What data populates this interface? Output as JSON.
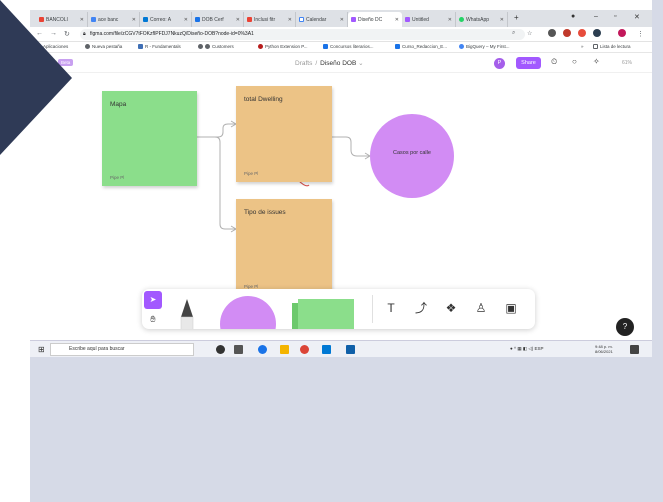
{
  "colors": {
    "slide_accent": "#2f3a56",
    "figma_purple": "#a259ff",
    "sticky_green": "#8bde8b",
    "sticky_orange": "#ecc386",
    "circle_purple": "#d28cf4"
  },
  "browser": {
    "tabs": [
      {
        "label": "BANCOLI",
        "favicon": "gmail-icon"
      },
      {
        "label": "ace banc",
        "favicon": "google-icon"
      },
      {
        "label": "Correo: A",
        "favicon": "outlook-icon"
      },
      {
        "label": "DOB Cerf",
        "favicon": "docs-icon"
      },
      {
        "label": "Inclusi fitr",
        "favicon": "gmail-icon"
      },
      {
        "label": "Calendar",
        "favicon": "calendar-icon"
      },
      {
        "label": "Diseño DC",
        "favicon": "figma-icon"
      },
      {
        "label": "Untitled",
        "favicon": "figma-icon"
      },
      {
        "label": "WhatsApp",
        "favicon": "whatsapp-icon"
      }
    ],
    "new_tab": "+",
    "url": "figma.com/file/zCGV7tFOKzfIPFDJ7NkuzQ/Diseño-DOB?node-id=0%3A1",
    "bookmarks": [
      "Aplicaciones",
      "Nueva pestaña",
      "R - Fundamentals",
      "Customers",
      "Python Extension P...",
      "Concursos literarios...",
      "Curso_Redaccion_E...",
      "BigQuery – My First..."
    ],
    "reading_list": "Lista de lectura"
  },
  "figma": {
    "beta_tag": "Beta",
    "breadcrumb_drafts": "Drafts",
    "breadcrumb_sep": "/",
    "doc_name": "Diseño DOB",
    "avatar_initial": "P",
    "share_label": "Share",
    "zoom": "61%"
  },
  "canvas": {
    "stickies": [
      {
        "title": "Mapa",
        "author": "Pipe Pl"
      },
      {
        "title": "total Dwelling",
        "author": "Pipe Pl"
      },
      {
        "title": "Tipo de issues",
        "author": "Pipe Pl"
      }
    ],
    "circle_label": "Casos por calle",
    "text_tool": "T"
  },
  "help_label": "?",
  "taskbar": {
    "search_placeholder": "Escribe aquí para buscar",
    "lang": "ESP",
    "time": "9:48 p. m.",
    "date": "8/06/2021"
  }
}
